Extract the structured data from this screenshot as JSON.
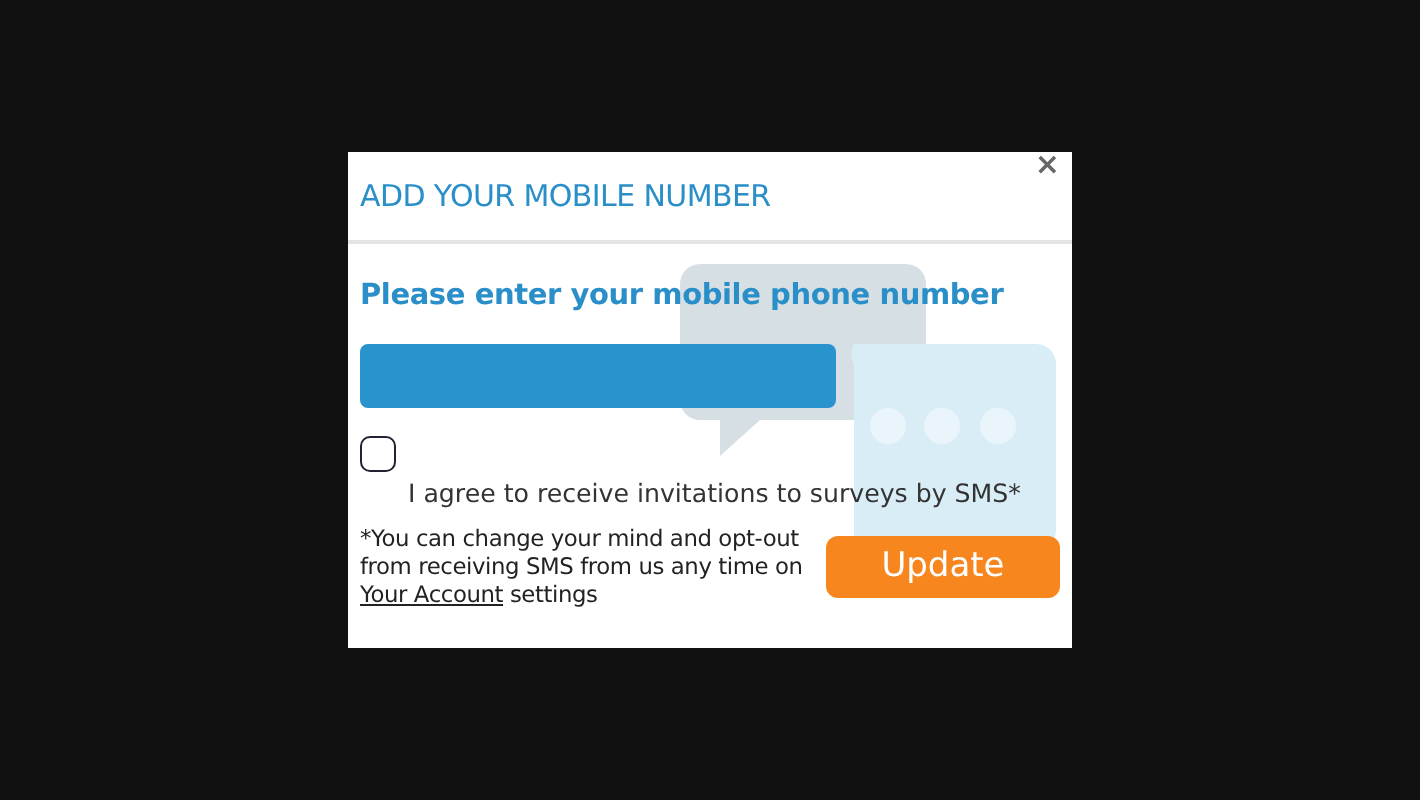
{
  "dialog": {
    "title": "ADD YOUR MOBILE NUMBER",
    "close": "×"
  },
  "prompt": "Please enter your mobile phone number",
  "consent": {
    "checked": false,
    "label": "I agree to receive invitations to surveys by SMS*"
  },
  "note": {
    "text_before": "*You can change your mind and opt-out from receiving SMS from us any time on ",
    "link": "Your Account",
    "text_after": " settings"
  },
  "buttons": [
    "Update"
  ]
}
